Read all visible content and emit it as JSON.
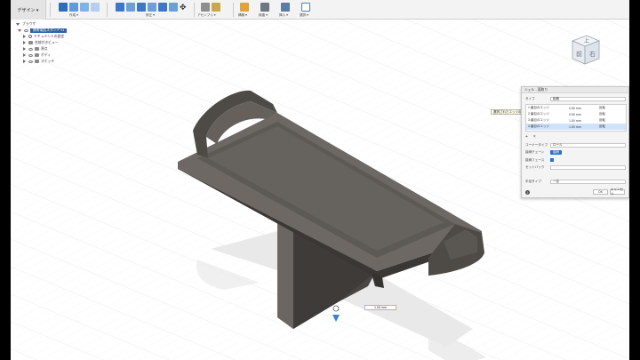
{
  "workspace": {
    "label": "デザイン ▾"
  },
  "toolbar": {
    "groups": [
      {
        "label": "作成 ▾"
      },
      {
        "label": "修正 ▾"
      },
      {
        "label": "アセンブリ ▾"
      },
      {
        "label": "構築 ▾"
      },
      {
        "label": "検査 ▾"
      },
      {
        "label": "挿入 ▾"
      },
      {
        "label": "選択 ▾"
      }
    ]
  },
  "browser": {
    "header": "ブラウザ",
    "document": "携帯電話スタンド v1",
    "items": [
      {
        "label": "ドキュメントの設定"
      },
      {
        "label": "名前付きビュー"
      },
      {
        "label": "原点"
      },
      {
        "label": "ボディ"
      },
      {
        "label": "スケッチ"
      }
    ]
  },
  "viewcube": {
    "top": "上",
    "front": "前",
    "right": "右"
  },
  "dialog": {
    "title": "シェル - 面取り",
    "type_label": "タイプ",
    "type_value": "距離",
    "rows": [
      {
        "name": "1 番目のエッジ",
        "value": "0.50 mm",
        "action": "反転"
      },
      {
        "name": "2 番目のエッジ",
        "value": "0.50 mm",
        "action": "反転"
      },
      {
        "name": "3 番目のエッジ",
        "value": "1.00 mm",
        "action": "反転"
      },
      {
        "name": "4 番目のエッジ",
        "value": "1.00 mm",
        "action": "反転"
      }
    ],
    "corner_type_label": "コーナータイプ",
    "corner_type_value": "ロール",
    "tangent_label": "接線チェーン",
    "tangent_value": "接続",
    "tangent_faces_label": "接線フェース",
    "setback_label": "セットバック",
    "radius_type_label": "半径タイプ",
    "radius_type_value": "一定",
    "ok": "OK",
    "cancel": "キャンセル"
  },
  "tooltip": "選択されたエッジの反転",
  "dim_input": {
    "value": "1.00 mm"
  },
  "colors": {
    "toolbar_bg": "#f3f3f3",
    "accent": "#2d6fc4",
    "model": "#55514c",
    "grid": "#d6dbe2"
  }
}
